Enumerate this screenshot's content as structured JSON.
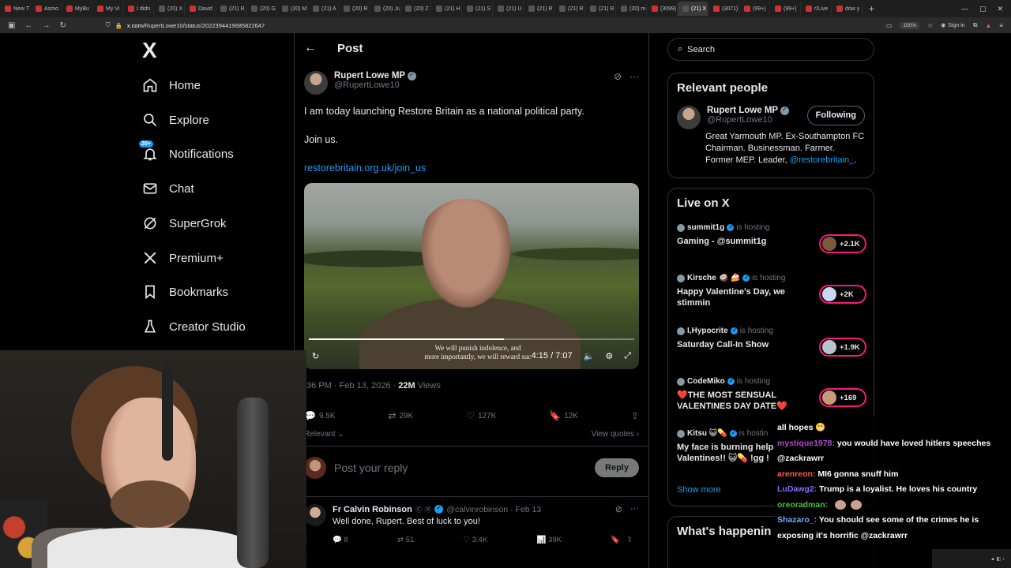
{
  "browser": {
    "tabs": [
      "New T",
      "Asmo",
      "MyBu",
      "My Vi",
      "I didn",
      "(20) X",
      "David",
      "(21) R",
      "(20) G",
      "(20) M",
      "(21) A",
      "(20) R",
      "(20) Ju",
      "(20) Z",
      "(21) H",
      "(21) S",
      "(21) U",
      "(21) R",
      "(21) R",
      "(21) R",
      "(20) m",
      "(3099)",
      "(21) X",
      "(3071)",
      "(99+)",
      "(99+)",
      "r/Live",
      "dow y"
    ],
    "active_tab_index": 22,
    "url_domain": "x.com",
    "url_path": "/RupertLowe10/status/2022394419685822647",
    "zoom": "150%",
    "signin_label": "Sign in"
  },
  "nav": {
    "logo": "X",
    "items": [
      {
        "label": "Home",
        "icon": "home-icon"
      },
      {
        "label": "Explore",
        "icon": "search-icon"
      },
      {
        "label": "Notifications",
        "icon": "bell-icon",
        "badge": "20+"
      },
      {
        "label": "Chat",
        "icon": "mail-icon"
      },
      {
        "label": "SuperGrok",
        "icon": "grok-icon"
      },
      {
        "label": "Premium+",
        "icon": "x-logo-icon"
      },
      {
        "label": "Bookmarks",
        "icon": "bookmark-icon"
      },
      {
        "label": "Creator Studio",
        "icon": "flask-icon"
      }
    ]
  },
  "post": {
    "header_title": "Post",
    "author_name": "Rupert Lowe MP",
    "author_handle": "@RupertLowe10",
    "text_line1": "I am today launching Restore Britain as a national political party.",
    "text_line2": "Join us.",
    "link": "restorebritain.org.uk/join_us",
    "video": {
      "time": "4:15 / 7:07",
      "progress": 0.6,
      "caption_line1": "We will punish indolence, and",
      "caption_line2": "more importantly, we will reward suc"
    },
    "timestamp": ":36 PM · Feb 13, 2026 · ",
    "views_count": "22M",
    "views_label": " Views",
    "stats": {
      "replies": "9.5K",
      "reposts": "29K",
      "likes": "127K",
      "bookmarks": "12K"
    },
    "relevant_label": "Relevant",
    "view_quotes_label": "View quotes",
    "reply_placeholder": "Post your reply",
    "reply_button": "Reply"
  },
  "reply": {
    "name": "Fr Calvin Robinson",
    "handle": "@calvinrobinson · Feb 13",
    "text": "Well done, Rupert. Best of luck to you!",
    "stats": {
      "replies": "8",
      "reposts": "51",
      "likes": "3.4K",
      "views": "39K"
    }
  },
  "sidebar": {
    "search_placeholder": "Search",
    "relevant_people_title": "Relevant people",
    "person": {
      "name": "Rupert Lowe MP",
      "handle": "@RupertLowe10",
      "follow_label": "Following",
      "bio": "Great Yarmouth MP. Ex-Southampton FC Chairman. Businessman. Farmer. Former MEP. Leader, ",
      "bio_mention": "@restorebritain_",
      "bio_tail": "."
    },
    "live_title": "Live on X",
    "live": [
      {
        "host": "summit1g",
        "status": "is hosting",
        "title": "Gaming - @summit1g",
        "count": "+2.1K"
      },
      {
        "host": "Kirsche 🥥 🍰",
        "status": "is hosting",
        "title": "Happy Valentine's Day, we stimmin",
        "count": "+2K"
      },
      {
        "host": "I,Hypocrite",
        "status": "is hosting",
        "title": "Saturday Call-In Show",
        "count": "+1.9K"
      },
      {
        "host": "CodeMiko",
        "status": "is hosting",
        "title": "❤️THE MOST SENSUAL VALENTINES DAY DATE❤️",
        "count": "+169"
      },
      {
        "host": "Kitsu 😺💊",
        "status": "is hostin",
        "title": "My face is burning help Valentines!! 😺💊 !gg !",
        "count": ""
      }
    ],
    "show_more": "Show more",
    "whats_happening": "What's happenin"
  },
  "chat": [
    {
      "user": "",
      "color": "#ffffff",
      "text": "all hopes 😬"
    },
    {
      "user": "mystique1978:",
      "color": "#b04ad1",
      "text": " you would have loved hitlers speeches @zackrawrr"
    },
    {
      "user": "arenreon:",
      "color": "#ff5a5a",
      "text": " MI6 gonna snuff him"
    },
    {
      "user": "LuDawg2:",
      "color": "#8a6cff",
      "text": " Trump is a loyalist. He loves his country"
    },
    {
      "user": "oreoradman:",
      "color": "#3fc53f",
      "text": " "
    },
    {
      "user": "Shazaro_:",
      "color": "#7aa8ff",
      "text": " You should see some of the crimes he is exposing it's horrific @zackrawrr"
    }
  ]
}
